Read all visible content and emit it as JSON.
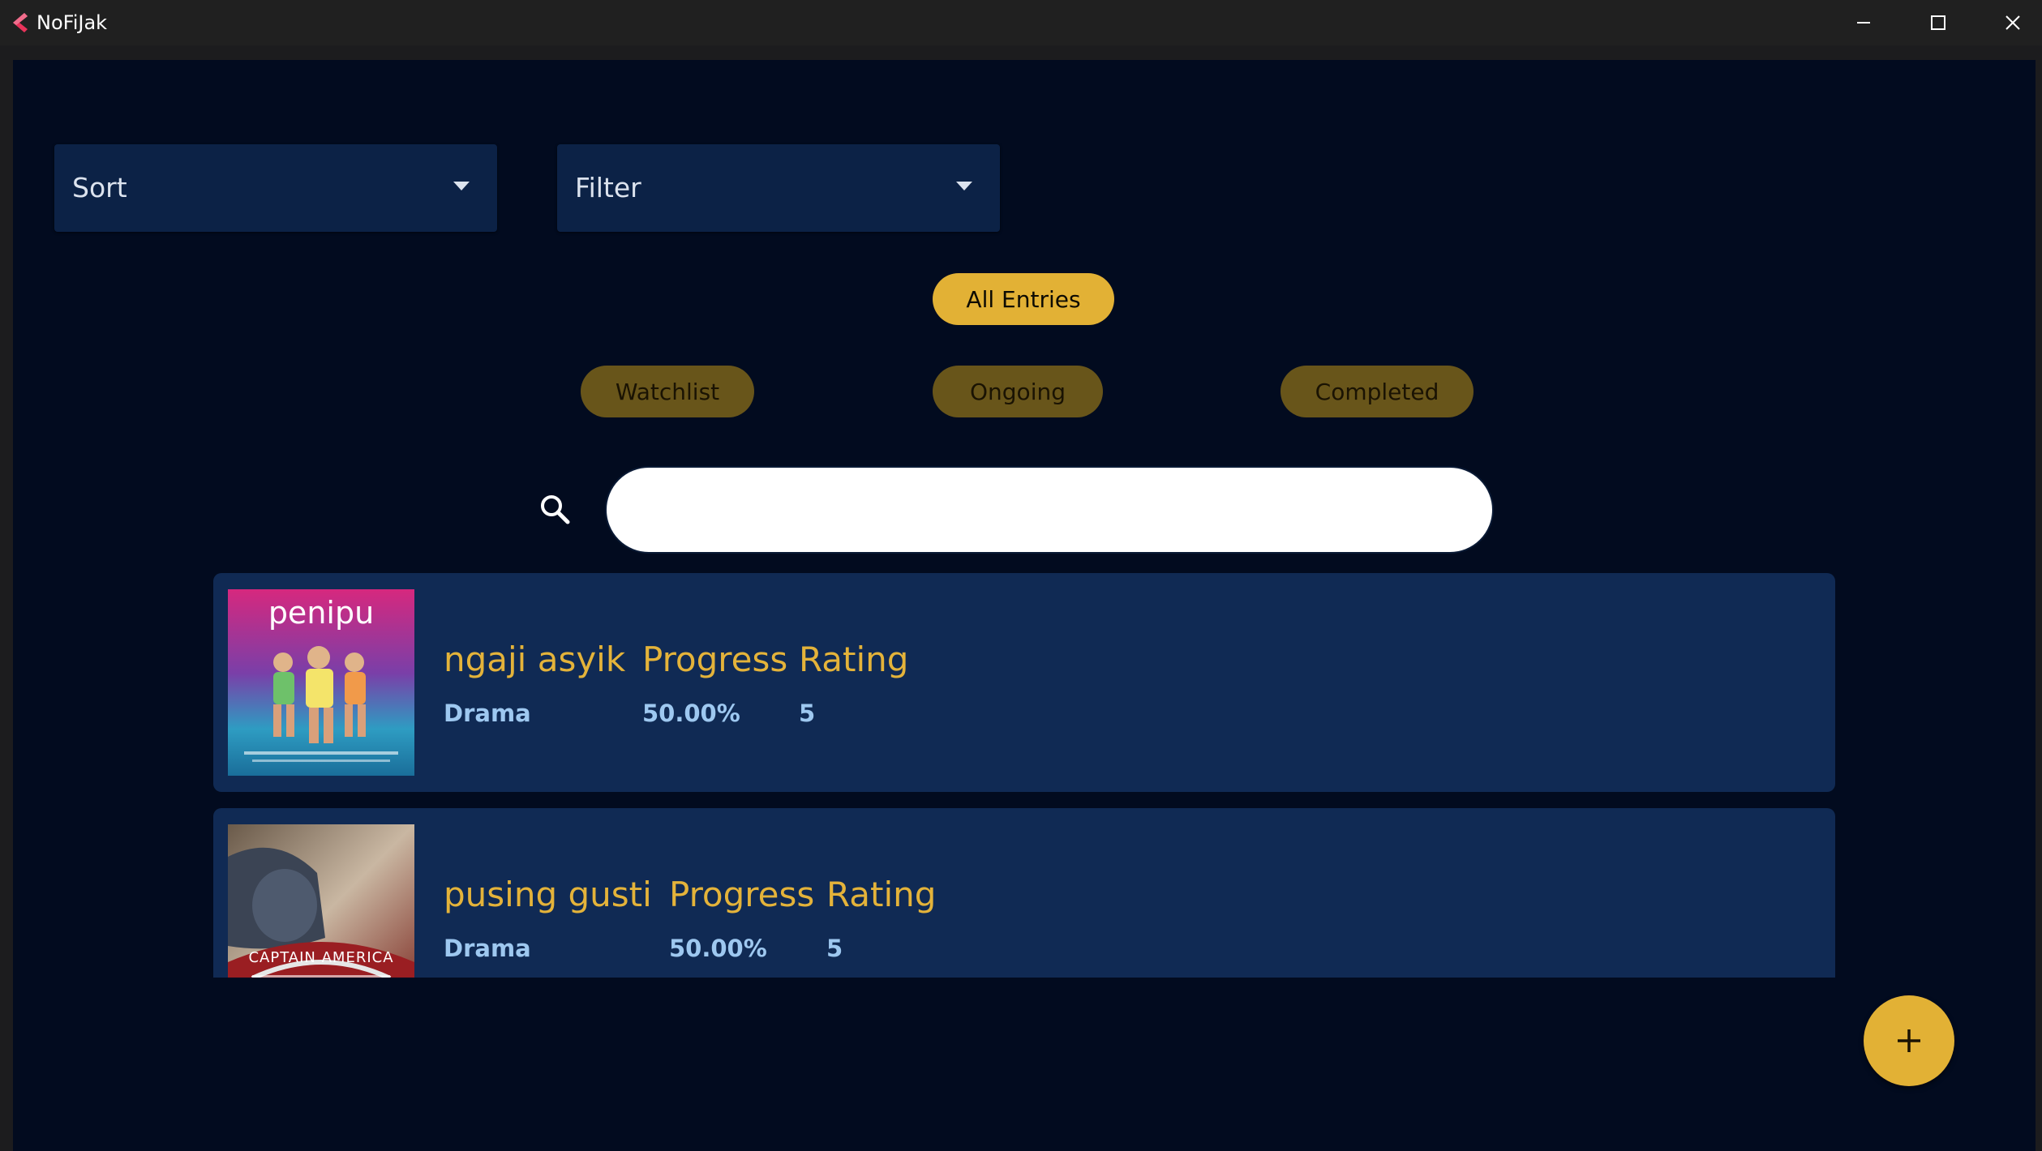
{
  "window": {
    "title": "NoFiJak",
    "controls": [
      "minimize-icon",
      "maximize-icon",
      "close-icon"
    ]
  },
  "toolbar": {
    "sort_label": "Sort",
    "filter_label": "Filter"
  },
  "chips": {
    "all": "All Entries",
    "watchlist": "Watchlist",
    "ongoing": "Ongoing",
    "completed": "Completed",
    "selected": "All Entries"
  },
  "search": {
    "value": "",
    "placeholder": ""
  },
  "entries": [
    {
      "title": "ngaji asyik",
      "genre": "Drama",
      "progress_label": "Progress",
      "progress": "50.00%",
      "rating_label": "Rating",
      "rating": "5",
      "poster_text": "penipu"
    },
    {
      "title": "pusing gusti",
      "genre": "Drama",
      "progress_label": "Progress",
      "progress": "50.00%",
      "rating_label": "Rating",
      "rating": "5",
      "poster_text": "CAPTAIN AMERICA"
    }
  ],
  "fab": {
    "icon": "plus-icon"
  },
  "colors": {
    "background": "#020b1f",
    "card": "#102a54",
    "accent": "#e2b135",
    "chip_inactive": "#68551a",
    "genre_text": "#9ec8f0"
  }
}
